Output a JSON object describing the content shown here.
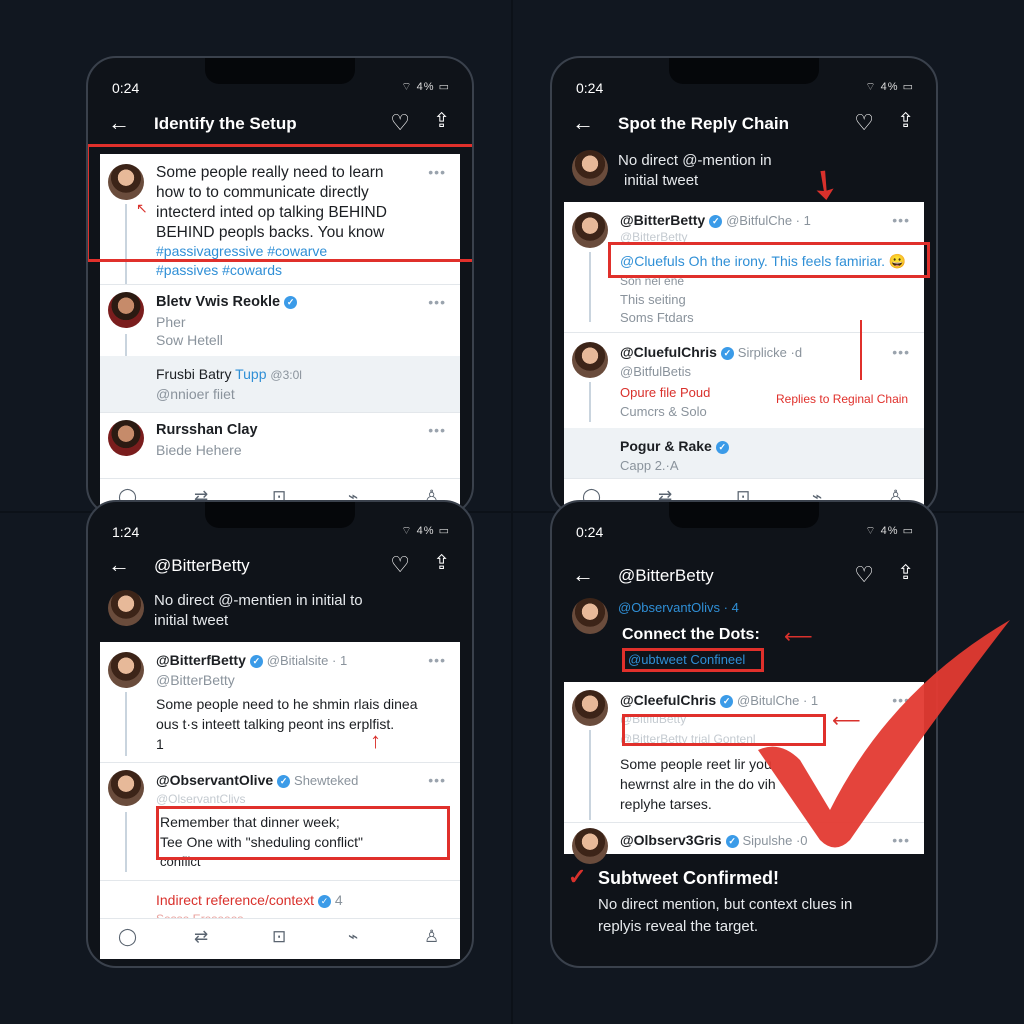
{
  "p1": {
    "time": "0:24",
    "status_icons": "⌔ 4% ▭",
    "title": "Identify the Setup",
    "tweet1": {
      "lines": [
        "Some people really need to learn",
        "how to to communicate directly",
        "intecterd inted op talking BEHIND",
        "BEHIND peopls backs. You know"
      ],
      "tags1": "#passivagressive #cowarve",
      "tags2": "#passives #cowards"
    },
    "tweet2": {
      "name": "Bletv Vwis Reokle",
      "line1": "Pher",
      "line2": "Sow Hetell"
    },
    "tweet3": {
      "name": "Frusbi Batry",
      "handle": "Tupp",
      "handle2": "@3:0l",
      "line1": "@nnioer fiiet"
    },
    "tweet4": {
      "name": "Rursshan Clay",
      "line1": "Biede Hehere"
    }
  },
  "p2": {
    "time": "0:24",
    "status_icons": "⌔ 4% ▭",
    "title": "Spot the Reply Chain",
    "intro1": "No direct @-mention in",
    "intro2": "initial tweet",
    "tweet1": {
      "name": "@BitterBetty",
      "handle": "@BitfulChe · 1",
      "handle_faded": "@BitterBetty",
      "highlight": "@Cluefuls Oh the irony. This feels famiriar. 😀",
      "line1": "Son nel ene",
      "line2": "This seiting",
      "line3": "Soms Ftdars"
    },
    "tweet2": {
      "name": "@CluefulChris",
      "handle": "Sirplicke ·d",
      "handle2": "@BitfulBetis",
      "red_line": "Opure file Poud",
      "line2": "Cumcrs & Solo"
    },
    "annotation": "Replies to Reginal Chain",
    "tweet3": {
      "name": "Pogur & Rake",
      "line1": "Capp 2.·A"
    }
  },
  "p3": {
    "time": "1:24",
    "status_icons": "⌔ 4% ▭",
    "title": "@BitterBetty",
    "intro1": "No direct @-mentien in initial to",
    "intro2": "initial tweet",
    "tweet1": {
      "name": "@BitterfBetty",
      "handle": "@Bitialsite · 1",
      "handle2": "@BitterBetty",
      "line1": "Some people need to he shmin rlais dinea",
      "line2": "ous t·s inteett talking peont ins erplfist.",
      "line3": "1"
    },
    "tweet2": {
      "name": "@ObservantOlive",
      "handle": "Shewteked",
      "handle2": "@OlservantClivs",
      "box1": "Remember that dinner week;",
      "box2": "Tee One with \"sheduling conflict\"",
      "box3": "conflict\""
    },
    "reference": "Indirect reference/context",
    "reference_badge": "4",
    "footer_line": "Sesse Ereseees"
  },
  "p4": {
    "time": "0:24",
    "status_icons": "⌔ 4% ▭",
    "title": "@BitterBetty",
    "handle_top": "@ObservantOlivs · 4",
    "connect": "Connect the Dots:",
    "subtweet_box": "@ubtweet Confineel",
    "tweet1": {
      "name": "@CleefulChris",
      "handle": "@BitulChe · 1",
      "handle2": "@BitfluBetty",
      "faded": "@BitterBetty  trial Gontenl",
      "line1": "Some people reet lir          you",
      "line2": "hewrnst alre in the do           vih",
      "line3": "replyhe tarses."
    },
    "tweet2": {
      "name": "@Olbserv3Gris",
      "handle": "Sipulshe ·0"
    },
    "verdict": "Subtweet Confirmed!",
    "verdict_body1": "No direct mention, but context clues in",
    "verdict_body2": "replyis reveal the target."
  },
  "icons": [
    "back-arrow-icon",
    "heart-icon",
    "share-icon",
    "reply-icon",
    "retweet-icon",
    "inbox-icon",
    "stats-icon",
    "profile-icon",
    "more-icon",
    "verified-icon",
    "checkmark-icon"
  ],
  "accent": "#e0302b",
  "link_color": "#2f8fd6"
}
